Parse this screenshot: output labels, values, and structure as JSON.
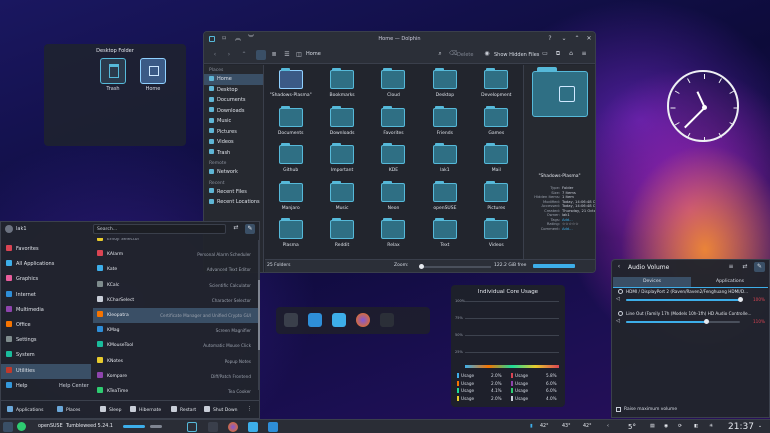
{
  "desktop_folder": {
    "title": "Desktop Folder",
    "items": [
      "Trash",
      "Home"
    ]
  },
  "dolphin": {
    "title": "Home — Dolphin",
    "breadcrumb": "Home",
    "toolbar": {
      "delete": "Delete",
      "hidden": "Show Hidden Files"
    },
    "places_header": "Places",
    "places": [
      "Home",
      "Desktop",
      "Documents",
      "Downloads",
      "Music",
      "Pictures",
      "Videos",
      "Trash"
    ],
    "remote_header": "Remote",
    "remote": [
      "Network"
    ],
    "recent_header": "Recent",
    "recent": [
      "Recent Files",
      "Recent Locations"
    ],
    "folders": [
      "\"Shadows-Plasma\"",
      "Bookmarks",
      "Cloud",
      "Desktop",
      "Development",
      "Documents",
      "Downloads",
      "Favorites",
      "Friends",
      "Games",
      "Github",
      "Important",
      "KDE",
      "lak1",
      "Mail",
      "Manjaro",
      "Music",
      "Neon",
      "openSUSE",
      "Pictures",
      "Plasma",
      "Reddit",
      "Relax",
      "Text",
      "Videos"
    ],
    "info": {
      "name": "\"Shadows-Plasma\"",
      "rows": [
        {
          "k": "Type:",
          "v": "Folder"
        },
        {
          "k": "Size:",
          "v": "7 items"
        },
        {
          "k": "Hidden items:",
          "v": "1 item"
        },
        {
          "k": "Modified:",
          "v": "Today, 14:06:48 CEST"
        },
        {
          "k": "Accessed:",
          "v": "Today, 14:06:48 CEST"
        },
        {
          "k": "Created:",
          "v": "Thursday, 21 October 2021 18:56:42 CEST"
        },
        {
          "k": "Owner:",
          "v": "lak1"
        },
        {
          "k": "Tags:",
          "v": "Add..."
        },
        {
          "k": "Rating:",
          "v": "☆☆☆☆☆"
        },
        {
          "k": "Comment:",
          "v": "Add..."
        }
      ]
    },
    "status": {
      "count": "25 Folders",
      "zoom_label": "Zoom:",
      "free": "122.2 GiB free"
    }
  },
  "launcher": {
    "user": "lak1",
    "search_placeholder": "Search...",
    "categories": [
      "Favorites",
      "All Applications",
      "Graphics",
      "Internet",
      "Multimedia",
      "Office",
      "Settings",
      "System",
      "Utilities",
      "Help"
    ],
    "help_center": "Help Center",
    "apps": [
      {
        "name": "Emoji Selector",
        "desc": ""
      },
      {
        "name": "KAlarm",
        "desc": "Personal Alarm Scheduler"
      },
      {
        "name": "Kate",
        "desc": "Advanced Text Editor"
      },
      {
        "name": "KCalc",
        "desc": "Scientific Calculator"
      },
      {
        "name": "KCharSelect",
        "desc": "Character Selector"
      },
      {
        "name": "Kleopatra",
        "desc": "Certificate Manager and Unified Crypto GUI"
      },
      {
        "name": "KMag",
        "desc": "Screen Magnifier"
      },
      {
        "name": "KMouseTool",
        "desc": "Automatic Mouse Click"
      },
      {
        "name": "KNotes",
        "desc": "Popup Notes"
      },
      {
        "name": "Kompare",
        "desc": "Diff/Patch Frontend"
      },
      {
        "name": "KTeaTime",
        "desc": "Tea Cooker"
      }
    ],
    "bottom": {
      "applications": "Applications",
      "places": "Places",
      "sleep": "Sleep",
      "hibernate": "Hibernate",
      "restart": "Restart",
      "shutdown": "Shut Down"
    }
  },
  "cores": {
    "title": "Individual Core Usage",
    "axis": [
      "100%",
      "75%",
      "50%",
      "25%"
    ],
    "rows": [
      {
        "l": "Usage",
        "a": "2.0%",
        "r": "Usage",
        "b": "5.8%"
      },
      {
        "l": "Usage",
        "a": "2.0%",
        "r": "Usage",
        "b": "6.0%"
      },
      {
        "l": "Usage",
        "a": "4.1%",
        "r": "Usage",
        "b": "6.0%"
      },
      {
        "l": "Usage",
        "a": "2.0%",
        "r": "Usage",
        "b": "4.0%"
      }
    ],
    "colors": [
      "#3daee9",
      "#f67400",
      "#1cdc9a",
      "#e8cb2d",
      "#da4453",
      "#8e44ad",
      "#2ecc71",
      "#c9ced8"
    ]
  },
  "audio": {
    "title": "Audio Volume",
    "tabs": [
      "Devices",
      "Applications"
    ],
    "devices": [
      {
        "name": "HDMI / DisplayPort 2 (Raven/Raven2/Fenghuang HDMI/D...",
        "pct": "100%",
        "level": 1.0
      },
      {
        "name": "Line Out (Family 17h (Models 10h-1fh) HD Audio Controlle...",
        "pct": "110%",
        "level": 0.7
      }
    ],
    "raise": "Raise maximum volume"
  },
  "taskbar": {
    "distro": "openSUSE",
    "version": "Tumbleweed 5.24.1",
    "temps": [
      "42°",
      "43°",
      "42°"
    ],
    "weather": "5°",
    "clock": "21:37"
  }
}
